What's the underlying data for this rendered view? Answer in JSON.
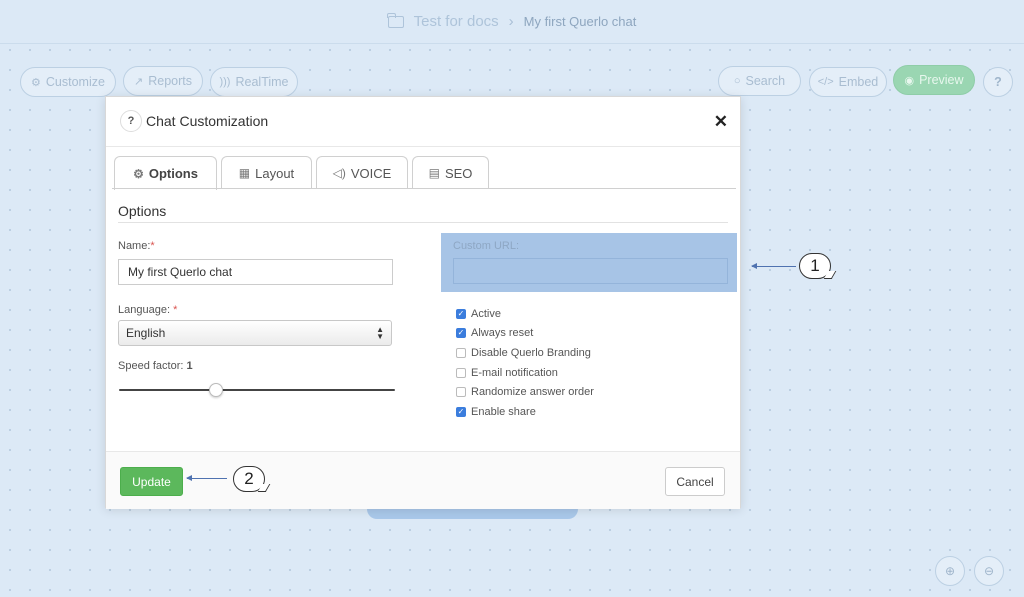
{
  "breadcrumb": {
    "root": "Test for docs",
    "separator": "›",
    "current": "My first Querlo chat"
  },
  "toolbar": {
    "customize": "Customize",
    "reports": "Reports",
    "realtime": "RealTime",
    "search": "Search",
    "embed": "Embed",
    "preview": "Preview",
    "help": "?"
  },
  "zoom": {
    "in_icon": "zoom-in-icon",
    "out_icon": "zoom-out-icon"
  },
  "modal": {
    "help_label": "?",
    "title": "Chat Customization",
    "close_label": "✕",
    "tabs": [
      {
        "label": "Options",
        "icon": "gears-icon",
        "active": true
      },
      {
        "label": "Layout",
        "icon": "layout-icon",
        "active": false
      },
      {
        "label": "VOICE",
        "icon": "speaker-icon",
        "active": false
      },
      {
        "label": "SEO",
        "icon": "document-icon",
        "active": false
      }
    ],
    "section_title": "Options",
    "name_label": "Name:",
    "name_value": "My first Querlo chat",
    "language_label": "Language:",
    "language_value": "English",
    "required_mark": "*",
    "speed_label": "Speed factor:",
    "speed_value": "1",
    "speed_level": 0.33,
    "custom_url_label": "Custom URL:",
    "custom_url_value": "",
    "checkboxes": [
      {
        "label": "Active",
        "checked": true
      },
      {
        "label": "Always reset",
        "checked": true
      },
      {
        "label": "Disable Querlo Branding",
        "checked": false
      },
      {
        "label": "E-mail notification",
        "checked": false
      },
      {
        "label": "Randomize answer order",
        "checked": false
      },
      {
        "label": "Enable share",
        "checked": true
      }
    ],
    "update_label": "Update",
    "cancel_label": "Cancel"
  },
  "callouts": {
    "first": "1",
    "second": "2"
  },
  "colors": {
    "accent_green": "#5cb85c",
    "highlight_blue": "#a7c4e6",
    "checkbox_blue": "#3b7ddd"
  }
}
